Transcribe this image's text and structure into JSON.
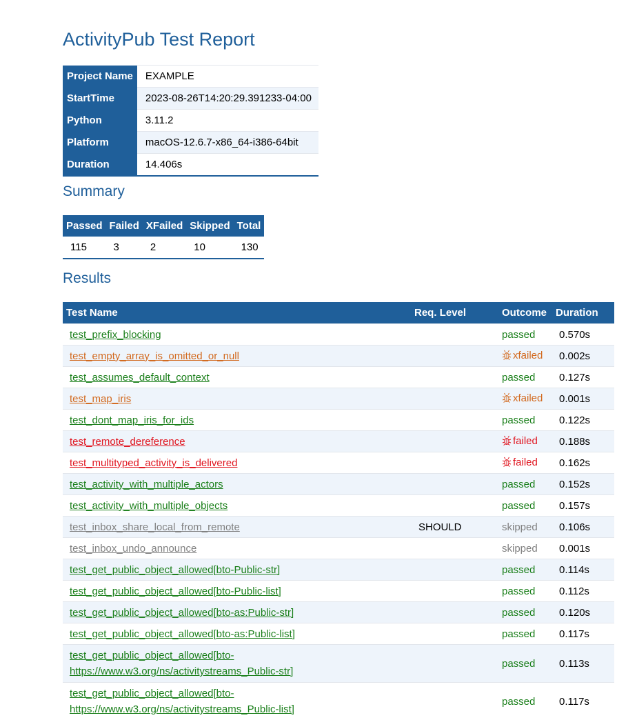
{
  "title": "ActivityPub Test Report",
  "info": [
    {
      "key": "Project Name",
      "value": "EXAMPLE"
    },
    {
      "key": "StartTime",
      "value": "2023-08-26T14:20:29.391233-04:00"
    },
    {
      "key": "Python",
      "value": "3.11.2"
    },
    {
      "key": "Platform",
      "value": "macOS-12.6.7-x86_64-i386-64bit"
    },
    {
      "key": "Duration",
      "value": "14.406s"
    }
  ],
  "summary": {
    "heading": "Summary",
    "headers": [
      "Passed",
      "Failed",
      "XFailed",
      "Skipped",
      "Total"
    ],
    "values": [
      "115",
      "3",
      "2",
      "10",
      "130"
    ]
  },
  "results": {
    "heading": "Results",
    "headers": {
      "name": "Test Name",
      "req": "Req. Level",
      "outcome": "Outcome",
      "duration": "Duration"
    },
    "rows": [
      {
        "name": "test_prefix_blocking",
        "req": "",
        "outcome": "passed",
        "duration": "0.570s"
      },
      {
        "name": "test_empty_array_is_omitted_or_null",
        "req": "",
        "outcome": "xfailed",
        "duration": "0.002s"
      },
      {
        "name": "test_assumes_default_context",
        "req": "",
        "outcome": "passed",
        "duration": "0.127s"
      },
      {
        "name": "test_map_iris",
        "req": "",
        "outcome": "xfailed",
        "duration": "0.001s"
      },
      {
        "name": "test_dont_map_iris_for_ids",
        "req": "",
        "outcome": "passed",
        "duration": "0.122s"
      },
      {
        "name": "test_remote_dereference",
        "req": "",
        "outcome": "failed",
        "duration": "0.188s"
      },
      {
        "name": "test_multityped_activity_is_delivered",
        "req": "",
        "outcome": "failed",
        "duration": "0.162s"
      },
      {
        "name": "test_activity_with_multiple_actors",
        "req": "",
        "outcome": "passed",
        "duration": "0.152s"
      },
      {
        "name": "test_activity_with_multiple_objects",
        "req": "",
        "outcome": "passed",
        "duration": "0.157s"
      },
      {
        "name": "test_inbox_share_local_from_remote",
        "req": "SHOULD",
        "outcome": "skipped",
        "duration": "0.106s"
      },
      {
        "name": "test_inbox_undo_announce",
        "req": "",
        "outcome": "skipped",
        "duration": "0.001s"
      },
      {
        "name": "test_get_public_object_allowed[bto-Public-str]",
        "req": "",
        "outcome": "passed",
        "duration": "0.114s"
      },
      {
        "name": "test_get_public_object_allowed[bto-Public-list]",
        "req": "",
        "outcome": "passed",
        "duration": "0.112s"
      },
      {
        "name": "test_get_public_object_allowed[bto-as:Public-str]",
        "req": "",
        "outcome": "passed",
        "duration": "0.120s"
      },
      {
        "name": "test_get_public_object_allowed[bto-as:Public-list]",
        "req": "",
        "outcome": "passed",
        "duration": "0.117s"
      },
      {
        "name": "test_get_public_object_allowed[bto-https://www.w3.org/ns/activitystreams_Public-str]",
        "name_lines": [
          "test_get_public_object_allowed[bto-",
          "https://www.w3.org/ns/activitystreams_Public-str]"
        ],
        "req": "",
        "outcome": "passed",
        "duration": "0.113s"
      },
      {
        "name": "test_get_public_object_allowed[bto-https://www.w3.org/ns/activitystreams_Public-list]",
        "name_lines": [
          "test_get_public_object_allowed[bto-",
          "https://www.w3.org/ns/activitystreams_Public-list]"
        ],
        "req": "",
        "outcome": "passed",
        "duration": "0.117s"
      }
    ]
  },
  "colors": {
    "accent": "#1f5f9a",
    "passed": "#1a7f1a",
    "xfailed": "#d2691e",
    "failed": "#e0141e",
    "skipped": "#808080"
  },
  "icons": {
    "xfailed": "bug-icon",
    "failed": "bug-icon"
  }
}
